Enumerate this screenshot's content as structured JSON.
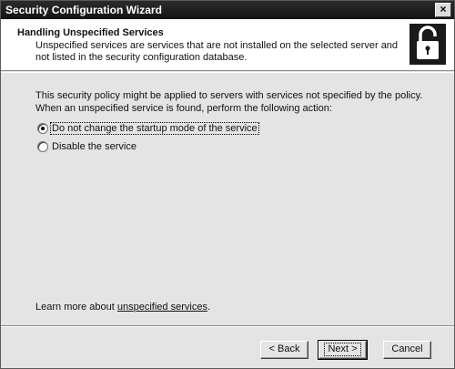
{
  "window": {
    "title": "Security Configuration Wizard",
    "close_glyph": "×"
  },
  "header": {
    "title": "Handling Unspecified Services",
    "description": "Unspecified services are services that are not installed on the selected server and not listed in the security configuration database.",
    "icon": "padlock-icon"
  },
  "body": {
    "intro": "This security policy might be applied to servers with services not specified by the policy. When an unspecified service is found, perform the following action:",
    "options": [
      {
        "label": "Do not change the startup mode of the service",
        "selected": true
      },
      {
        "label": "Disable the service",
        "selected": false
      }
    ],
    "learn_prefix": "Learn more about ",
    "learn_link": "unspecified services",
    "learn_suffix": "."
  },
  "buttons": {
    "back": "< Back",
    "next": "Next >",
    "cancel": "Cancel"
  }
}
